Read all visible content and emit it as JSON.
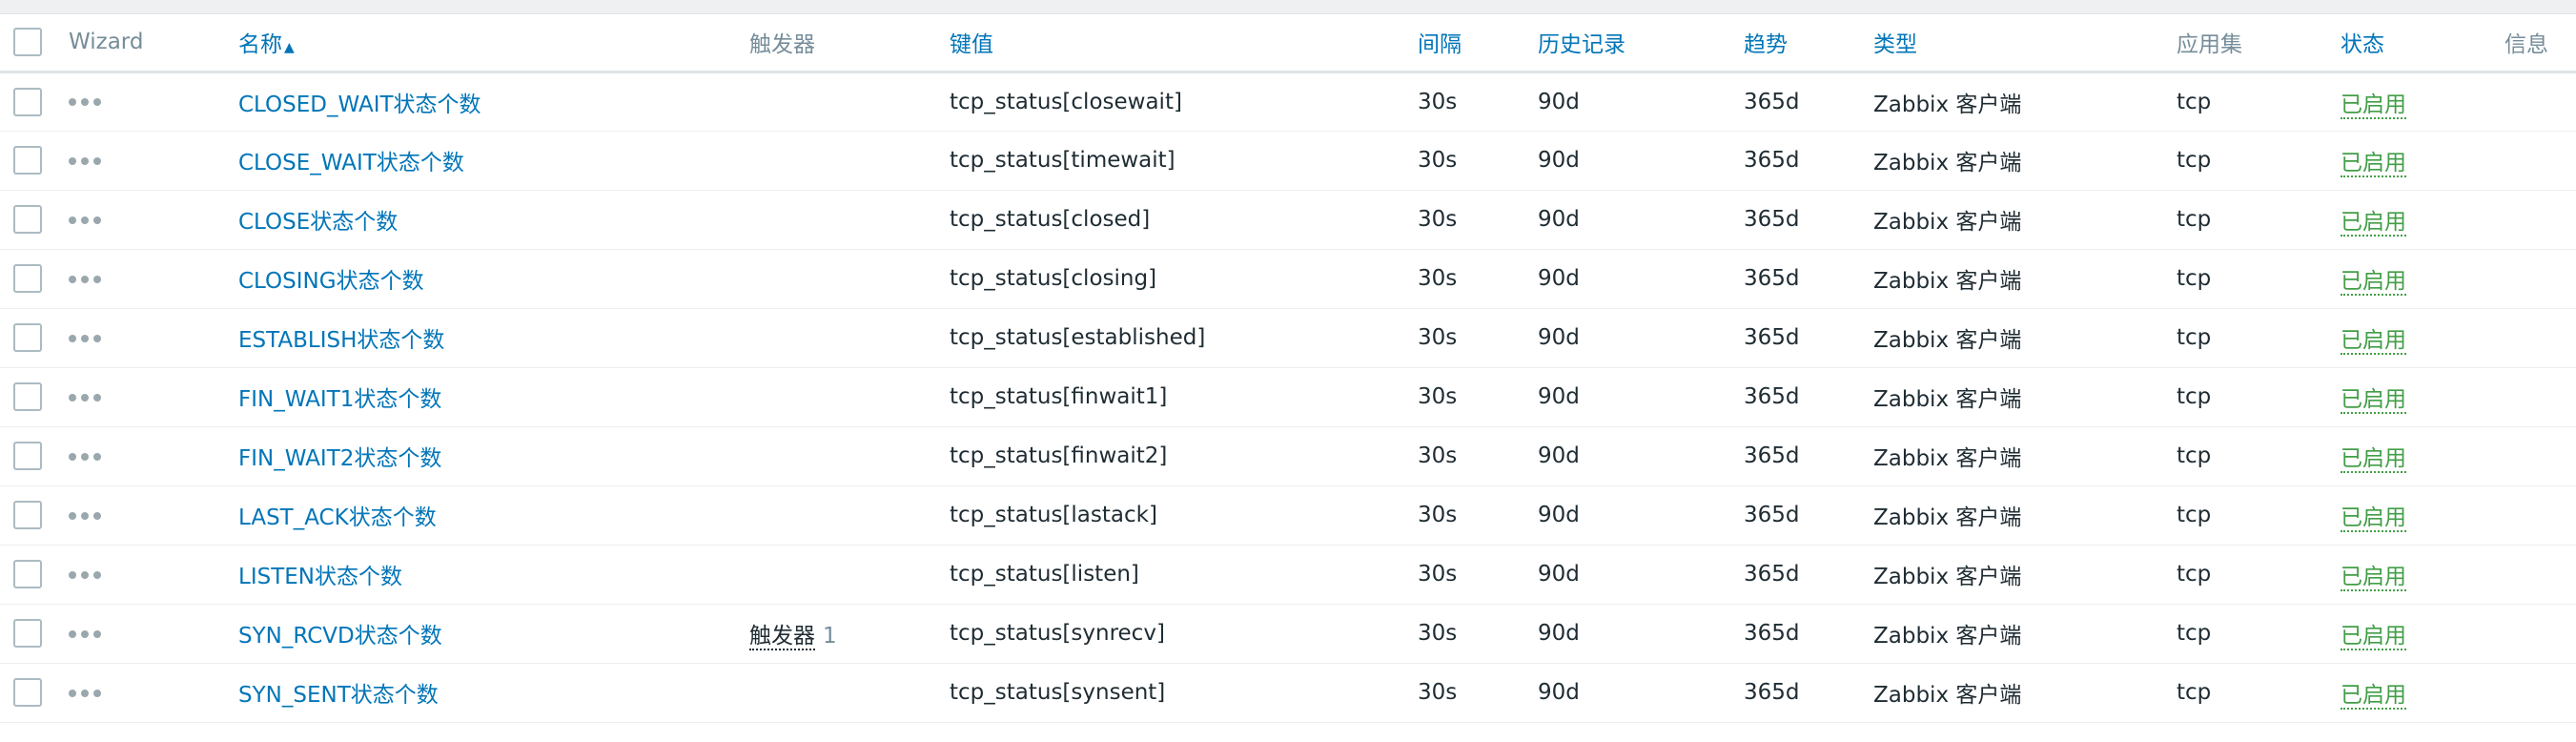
{
  "columns": {
    "wizard": "Wizard",
    "name": "名称",
    "sort_icon": "sort-ascending-icon",
    "triggers": "触发器",
    "key": "键值",
    "interval": "间隔",
    "history": "历史记录",
    "trends": "趋势",
    "type": "类型",
    "applications": "应用集",
    "status": "状态",
    "info": "信息"
  },
  "rows": [
    {
      "name": "CLOSED_WAIT状态个数",
      "trigger_label": "",
      "trigger_count": "",
      "key": "tcp_status[closewait]",
      "interval": "30s",
      "history": "90d",
      "trends": "365d",
      "type": "Zabbix 客户端",
      "applications": "tcp",
      "status": "已启用"
    },
    {
      "name": "CLOSE_WAIT状态个数",
      "trigger_label": "",
      "trigger_count": "",
      "key": "tcp_status[timewait]",
      "interval": "30s",
      "history": "90d",
      "trends": "365d",
      "type": "Zabbix 客户端",
      "applications": "tcp",
      "status": "已启用"
    },
    {
      "name": "CLOSE状态个数",
      "trigger_label": "",
      "trigger_count": "",
      "key": "tcp_status[closed]",
      "interval": "30s",
      "history": "90d",
      "trends": "365d",
      "type": "Zabbix 客户端",
      "applications": "tcp",
      "status": "已启用"
    },
    {
      "name": "CLOSING状态个数",
      "trigger_label": "",
      "trigger_count": "",
      "key": "tcp_status[closing]",
      "interval": "30s",
      "history": "90d",
      "trends": "365d",
      "type": "Zabbix 客户端",
      "applications": "tcp",
      "status": "已启用"
    },
    {
      "name": "ESTABLISH状态个数",
      "trigger_label": "",
      "trigger_count": "",
      "key": "tcp_status[established]",
      "interval": "30s",
      "history": "90d",
      "trends": "365d",
      "type": "Zabbix 客户端",
      "applications": "tcp",
      "status": "已启用"
    },
    {
      "name": "FIN_WAIT1状态个数",
      "trigger_label": "",
      "trigger_count": "",
      "key": "tcp_status[finwait1]",
      "interval": "30s",
      "history": "90d",
      "trends": "365d",
      "type": "Zabbix 客户端",
      "applications": "tcp",
      "status": "已启用"
    },
    {
      "name": "FIN_WAIT2状态个数",
      "trigger_label": "",
      "trigger_count": "",
      "key": "tcp_status[finwait2]",
      "interval": "30s",
      "history": "90d",
      "trends": "365d",
      "type": "Zabbix 客户端",
      "applications": "tcp",
      "status": "已启用"
    },
    {
      "name": "LAST_ACK状态个数",
      "trigger_label": "",
      "trigger_count": "",
      "key": "tcp_status[lastack]",
      "interval": "30s",
      "history": "90d",
      "trends": "365d",
      "type": "Zabbix 客户端",
      "applications": "tcp",
      "status": "已启用"
    },
    {
      "name": "LISTEN状态个数",
      "trigger_label": "",
      "trigger_count": "",
      "key": "tcp_status[listen]",
      "interval": "30s",
      "history": "90d",
      "trends": "365d",
      "type": "Zabbix 客户端",
      "applications": "tcp",
      "status": "已启用"
    },
    {
      "name": "SYN_RCVD状态个数",
      "trigger_label": "触发器",
      "trigger_count": "1",
      "key": "tcp_status[synrecv]",
      "interval": "30s",
      "history": "90d",
      "trends": "365d",
      "type": "Zabbix 客户端",
      "applications": "tcp",
      "status": "已启用"
    },
    {
      "name": "SYN_SENT状态个数",
      "trigger_label": "",
      "trigger_count": "",
      "key": "tcp_status[synsent]",
      "interval": "30s",
      "history": "90d",
      "trends": "365d",
      "type": "Zabbix 客户端",
      "applications": "tcp",
      "status": "已启用"
    }
  ],
  "colors": {
    "link": "#0275b8",
    "status_enabled": "#429e47",
    "header_gray": "#768d99"
  }
}
